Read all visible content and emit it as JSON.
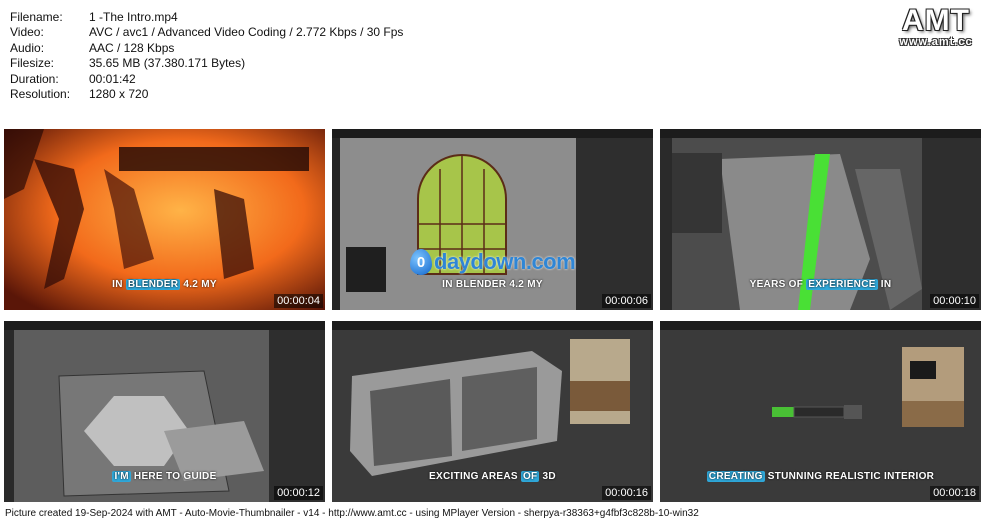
{
  "meta": {
    "rows": [
      {
        "key": "Filename:",
        "value": "1 -The Intro.mp4"
      },
      {
        "key": "Video:",
        "value": "AVC / avc1 / Advanced Video Coding / 2.772 Kbps / 30 Fps"
      },
      {
        "key": "Audio:",
        "value": "AAC / 128 Kbps"
      },
      {
        "key": "Filesize:",
        "value": "35.65 MB (37.380.171 Bytes)"
      },
      {
        "key": "Duration:",
        "value": "00:01:42"
      },
      {
        "key": "Resolution:",
        "value": "1280 x 720"
      }
    ]
  },
  "logo": {
    "main": "AMT",
    "sub": "www.amt.cc"
  },
  "watermark": {
    "drop": "0",
    "word": "daydown.com"
  },
  "thumbs": [
    {
      "time": "00:00:04",
      "cap": [
        {
          "t": "IN "
        },
        {
          "t": "BLENDER",
          "hl": "#2fa7d8"
        },
        {
          "t": " 4.2 MY"
        }
      ]
    },
    {
      "time": "00:00:06",
      "cap": [
        {
          "t": "IN "
        },
        {
          "t": "BLENDER",
          "hl": ""
        },
        {
          "t": " 4.2 MY"
        }
      ]
    },
    {
      "time": "00:00:10",
      "cap": [
        {
          "t": "YEARS OF "
        },
        {
          "t": "EXPERIENCE",
          "hl": "#2fa7d8"
        },
        {
          "t": " IN"
        }
      ]
    },
    {
      "time": "00:00:12",
      "cap": [
        {
          "t": "I'M",
          "hl": "#2fa7d8"
        },
        {
          "t": " HERE TO GUIDE"
        }
      ]
    },
    {
      "time": "00:00:16",
      "cap": [
        {
          "t": "EXCITING AREAS "
        },
        {
          "t": "OF",
          "hl": "#2fa7d8"
        },
        {
          "t": " 3D"
        }
      ]
    },
    {
      "time": "00:00:18",
      "cap": [
        {
          "t": "CREATING",
          "hl": "#2fa7d8"
        },
        {
          "t": " STUNNING REALISTIC INTERIOR"
        }
      ]
    }
  ],
  "footer": "Picture created 19-Sep-2024 with AMT - Auto-Movie-Thumbnailer - v14 - http://www.amt.cc - using MPlayer Version - sherpya-r38363+g4fbf3c828b-10-win32"
}
